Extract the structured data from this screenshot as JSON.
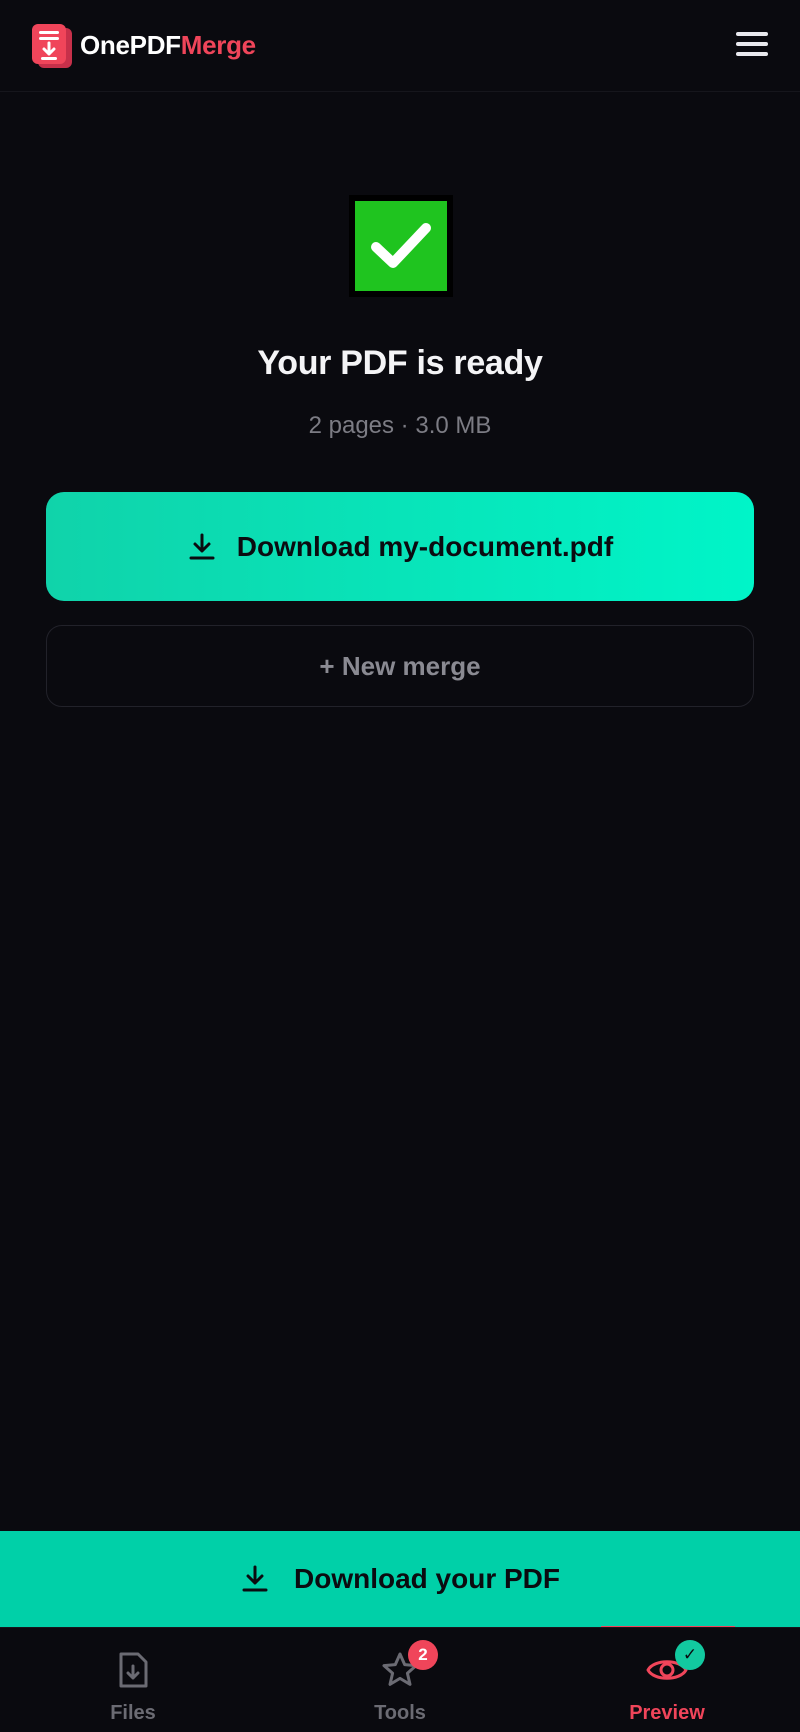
{
  "header": {
    "brand_part1": "OnePDF",
    "brand_part2": "Merge",
    "logo_icon": "pdf-download-logo-icon",
    "menu_icon": "hamburger-menu-icon"
  },
  "result": {
    "status_icon": "checkmark-icon",
    "title": "Your PDF is ready",
    "meta": "2 pages · 3.0 MB",
    "download_label": "Download my-document.pdf",
    "new_merge_label": "+ New merge"
  },
  "bottom_bar": {
    "download_label": "Download your PDF"
  },
  "tabs": [
    {
      "label": "Files",
      "icon": "file-download-icon",
      "active": false
    },
    {
      "label": "Tools",
      "icon": "star-icon",
      "badge": "2",
      "active": false
    },
    {
      "label": "Preview",
      "icon": "eye-icon",
      "badge": "✓",
      "active": true
    }
  ],
  "colors": {
    "background": "#0a0a0f",
    "accent_red": "#f0455a",
    "accent_teal": "#00f5c8",
    "success_green": "#1fc41f"
  }
}
